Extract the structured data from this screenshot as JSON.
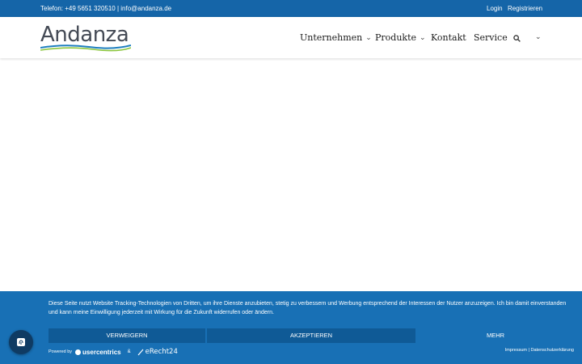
{
  "topbar": {
    "contact": "Telefon: +49 5651 320510 | info@andanza.de",
    "login": "Login",
    "register": "Registrieren"
  },
  "header": {
    "logo_text": "Andanza",
    "nav": [
      {
        "label": "Unternehmen",
        "has_dropdown": true
      },
      {
        "label": "Produkte",
        "has_dropdown": true
      },
      {
        "label": "Kontakt",
        "has_dropdown": false
      },
      {
        "label": "Service",
        "has_dropdown": false
      }
    ],
    "icons": [
      "search-icon",
      "chevron-down-icon"
    ]
  },
  "consent": {
    "text": "Diese Seite nutzt Website Tracking-Technologien von Dritten, um ihre Dienste anzubieten, stetig zu verbessern und Werbung entsprechend der Interessen der Nutzer anzuzeigen. Ich bin damit einverstanden und kann meine Einwilligung jederzeit mit Wirkung für die Zukunft widerrufen oder ändern.",
    "reject": "VERWEIGERN",
    "accept": "AKZEPTIEREN",
    "more": "MEHR",
    "powered_by": "Powered by",
    "usercentrics": "usercentrics",
    "amp": "&",
    "erecht": "eRecht24",
    "impressum": "Impressum",
    "separator": "|",
    "privacy": "Datenschutzerklärung"
  },
  "colors": {
    "topbar": "#1565a8",
    "consent_bg": "#1870b5",
    "button_bg": "#0f5a96",
    "fingerprint_bg": "#0f3b63",
    "logo_wave_blue": "#1f7fbf",
    "logo_wave_green": "#8cc63f"
  }
}
